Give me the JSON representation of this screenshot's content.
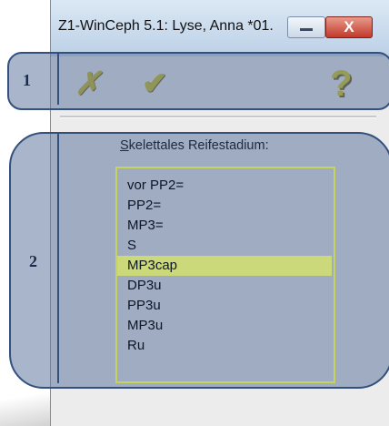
{
  "window": {
    "title": "Z1-WinCeph 5.1: Lyse, Anna *01.",
    "close_label": "X"
  },
  "toolbar": {
    "cancel_icon": "x-icon",
    "ok_icon": "check-icon",
    "help_icon": "help-icon",
    "help_glyph": "?"
  },
  "callouts": {
    "one": "1",
    "two": "2"
  },
  "list": {
    "label_accel": "S",
    "label_rest": "kelettales Reifestadium:",
    "items": [
      "vor PP2=",
      "PP2=",
      "MP3=",
      "S",
      "MP3cap",
      "DP3u",
      "PP3u",
      "MP3u",
      "Ru"
    ],
    "selected": "MP3cap"
  }
}
